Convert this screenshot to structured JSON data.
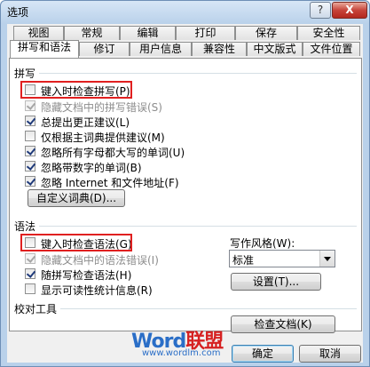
{
  "window": {
    "title": "选项",
    "help_label": "?",
    "close_label": "X"
  },
  "tabs_row1": [
    {
      "label": "视图"
    },
    {
      "label": "常规"
    },
    {
      "label": "编辑"
    },
    {
      "label": "打印"
    },
    {
      "label": "保存"
    },
    {
      "label": "安全性"
    }
  ],
  "tabs_row2": [
    {
      "label": "拼写和语法"
    },
    {
      "label": "修订"
    },
    {
      "label": "用户信息"
    },
    {
      "label": "兼容性"
    },
    {
      "label": "中文版式"
    },
    {
      "label": "文件位置"
    }
  ],
  "spelling": {
    "header": "拼写",
    "options": [
      {
        "label": "键入时检查拼写(P)",
        "checked": false,
        "enabled": true
      },
      {
        "label": "隐藏文档中的拼写错误(S)",
        "checked": true,
        "enabled": false
      },
      {
        "label": "总提出更正建议(L)",
        "checked": true,
        "enabled": true
      },
      {
        "label": "仅根据主词典提供建议(M)",
        "checked": false,
        "enabled": true
      },
      {
        "label": "忽略所有字母都大写的单词(U)",
        "checked": true,
        "enabled": true
      },
      {
        "label": "忽略带数字的单词(B)",
        "checked": true,
        "enabled": true
      },
      {
        "label": "忽略 Internet 和文件地址(F)",
        "checked": true,
        "enabled": true
      }
    ],
    "custom_dict_button": "自定义词典(D)..."
  },
  "grammar": {
    "header": "语法",
    "options": [
      {
        "label": "键入时检查语法(G)",
        "checked": false,
        "enabled": true
      },
      {
        "label": "隐藏文档中的语法错误(I)",
        "checked": true,
        "enabled": false
      },
      {
        "label": "随拼写检查语法(H)",
        "checked": true,
        "enabled": true
      },
      {
        "label": "显示可读性统计信息(R)",
        "checked": false,
        "enabled": true
      }
    ],
    "writing_style_label": "写作风格(W):",
    "writing_style_value": "标准",
    "settings_button": "设置(T)..."
  },
  "proofing": {
    "header": "校对工具",
    "recheck_button": "检查文档(K)"
  },
  "footer": {
    "ok_label": "确定",
    "cancel_label": "取消"
  },
  "watermark": {
    "brand_en": "Word",
    "brand_cn": "联盟",
    "url": "www.wordlm.com"
  },
  "colors": {
    "highlight_box": "#e02020",
    "title_bar": "#b9d1ea"
  }
}
